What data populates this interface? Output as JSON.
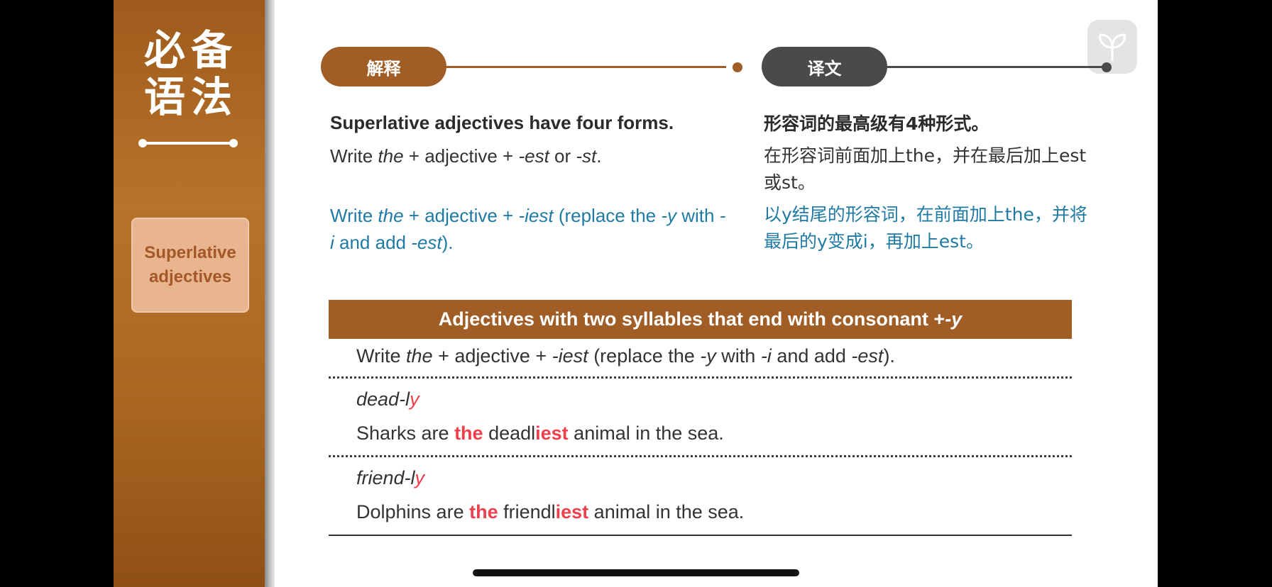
{
  "sidebar": {
    "title_line1": "必备",
    "title_line2": "语法",
    "card_line1": "Superlative",
    "card_line2": "adjectives"
  },
  "tabs": {
    "explain": "解释",
    "translation": "译文"
  },
  "explain": {
    "heading": "Superlative adjectives have four forms.",
    "rule1": {
      "p1": "Write ",
      "the": "the",
      "p2": " + adjective + ",
      "est": "-est",
      "p3": " or ",
      "st": "-st",
      "p4": "."
    },
    "rule2": {
      "p1": "Write ",
      "the": "the",
      "p2": " + adjective + ",
      "iest": "-iest",
      "p3": " (replace the ",
      "y": "-y",
      "p4": " with ",
      "i": "-i",
      "p5": " and add ",
      "est": "-est",
      "p6": ")."
    }
  },
  "translation": {
    "heading": "形容词的最高级有4种形式。",
    "rule1": "在形容词前面加上the，并在最后加上est或st。",
    "rule2": "以y结尾的形容词，在前面加上the，并将最后的y变成i，再加上est。"
  },
  "table": {
    "header": {
      "text": "Adjectives with two syllables that end with consonant + ",
      "y": "-y"
    },
    "rule": {
      "p1": "Write ",
      "the": "the",
      "p2": " + adjective + ",
      "iest": "-iest",
      "p3": " (replace the ",
      "y": "-y",
      "p4": " with ",
      "i": "-i",
      "p5": " and add ",
      "est": "-est",
      "p6": ")."
    },
    "rows": [
      {
        "word_stem": "dead-l",
        "word_end": "y",
        "ex_p1": "Sharks are ",
        "ex_the": "the",
        "ex_p2": " deadl",
        "ex_iest": "iest",
        "ex_p3": " animal in the sea."
      },
      {
        "word_stem": "friend-l",
        "word_end": "y",
        "ex_p1": "Dolphins are ",
        "ex_the": "the",
        "ex_p2": " friendl",
        "ex_iest": "iest",
        "ex_p3": " animal in the sea."
      }
    ]
  },
  "colors": {
    "brown": "#a05e26",
    "gray": "#4a4a4a",
    "blue_text": "#1f7aa6",
    "red_highlight": "#ee3f4d"
  },
  "icons": {
    "logo": "sprout-leaf-icon"
  }
}
